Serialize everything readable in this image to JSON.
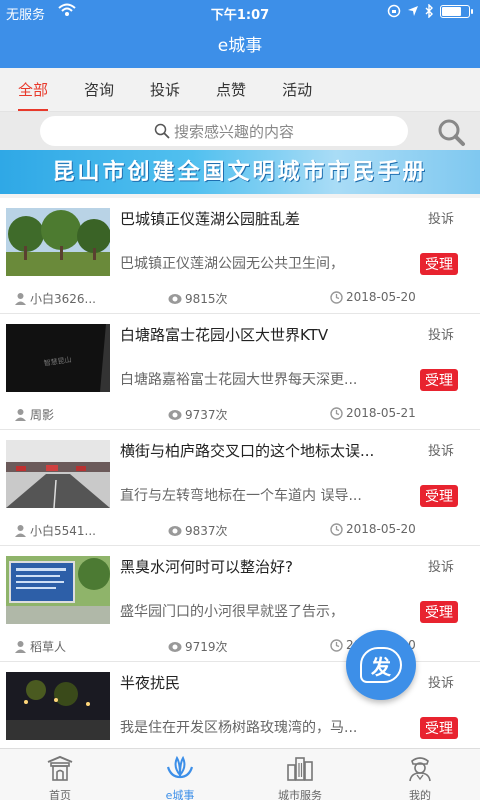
{
  "status_bar": {
    "carrier": "无服务",
    "time": "下午1:07",
    "battery_level": 0.75
  },
  "header": {
    "title": "e城事"
  },
  "tabs": [
    {
      "label": "全部",
      "active": true
    },
    {
      "label": "咨询",
      "active": false
    },
    {
      "label": "投诉",
      "active": false
    },
    {
      "label": "点赞",
      "active": false
    },
    {
      "label": "活动",
      "active": false
    }
  ],
  "search": {
    "placeholder": "搜索感兴趣的内容"
  },
  "banner": {
    "text": "昆山市创建全国文明城市市民手册"
  },
  "posts": [
    {
      "title": "巴城镇正仪莲湖公园脏乱差",
      "type": "投诉",
      "summary": "巴城镇正仪莲湖公园无公共卫生间，",
      "status": "受理",
      "user": "小白3626...",
      "views": "9815次",
      "date": "2018-05-20",
      "thumb": "park-trees"
    },
    {
      "title": "白塘路富士花园小区大世界KTV",
      "type": "投诉",
      "summary": "白塘路嘉裕富士花园大世界每天深更...",
      "status": "受理",
      "user": "周影",
      "views": "9737次",
      "date": "2018-05-21",
      "thumb": "night-dark",
      "thumb_watermark": "智慧昆山"
    },
    {
      "title": "横街与柏庐路交叉口的这个地标太误...",
      "type": "投诉",
      "summary": "直行与左转弯地标在一个车道内 误导...",
      "status": "受理",
      "user": "小白5541...",
      "views": "9837次",
      "date": "2018-05-20",
      "thumb": "road-traffic"
    },
    {
      "title": "黑臭水河何时可以整治好?",
      "type": "投诉",
      "summary": "盛华园门口的小河很早就竖了告示，",
      "status": "受理",
      "user": "稻草人",
      "views": "9719次",
      "date": "2018-05-20",
      "thumb": "river-sign"
    },
    {
      "title": "半夜扰民",
      "type": "投诉",
      "summary": "我是住在开发区杨树路玫瑰湾的，马...",
      "status": "受理",
      "user": "",
      "views": "",
      "date": "",
      "thumb": "night-street"
    }
  ],
  "fab": {
    "label": "发"
  },
  "bottom_nav": [
    {
      "label": "首页",
      "icon": "home-gate-icon",
      "active": false
    },
    {
      "label": "e城事",
      "icon": "lotus-icon",
      "active": true
    },
    {
      "label": "城市服务",
      "icon": "city-buildings-icon",
      "active": false
    },
    {
      "label": "我的",
      "icon": "profile-icon",
      "active": false
    }
  ],
  "colors": {
    "primary": "#3d8fe8",
    "accent_red": "#e8392b",
    "badge_red": "#e8232f"
  }
}
